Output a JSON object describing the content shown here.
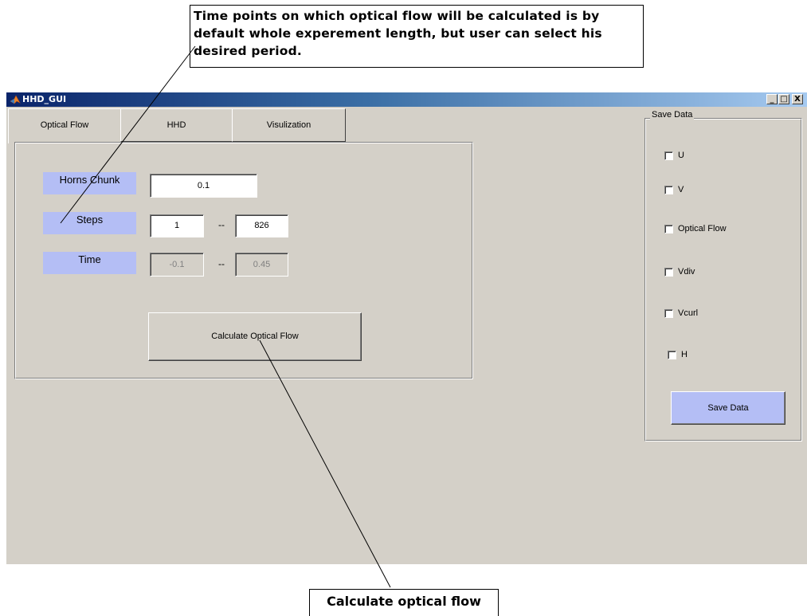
{
  "callouts": {
    "top_line1": "Time points on which optical flow will be calculated is by",
    "top_line2": "default whole experement length, but user can select his",
    "top_line3": "desired period.",
    "bottom": "Calculate optical flow"
  },
  "window": {
    "title": "HHD_GUI",
    "minimize": "_",
    "maximize": "□",
    "close": "X"
  },
  "tabs": {
    "optical_flow": "Optical Flow",
    "hhd": "HHD",
    "visualization": "Visulization"
  },
  "panel": {
    "horns_chunk_label": "Horns Chunk",
    "horns_chunk_value": "0.1",
    "steps_label": "Steps",
    "steps_from": "1",
    "steps_sep": "--",
    "steps_to": "826",
    "time_label": "Time",
    "time_from": "-0.1",
    "time_sep": "--",
    "time_to": "0.45",
    "calculate_button": "Calculate Optical Flow"
  },
  "save_data": {
    "title": "Save Data",
    "checkboxes": [
      "U",
      "V",
      "Optical Flow",
      "Vdiv",
      "Vcurl",
      "H"
    ],
    "button": "Save Data"
  },
  "colors": {
    "window_bg": "#d4d0c8",
    "label_bg": "#b4bef5",
    "title_start": "#0a246a",
    "title_end": "#a6caf0"
  },
  "icons": [
    "matlab-logo-icon",
    "minimize-icon",
    "maximize-icon",
    "close-icon"
  ]
}
